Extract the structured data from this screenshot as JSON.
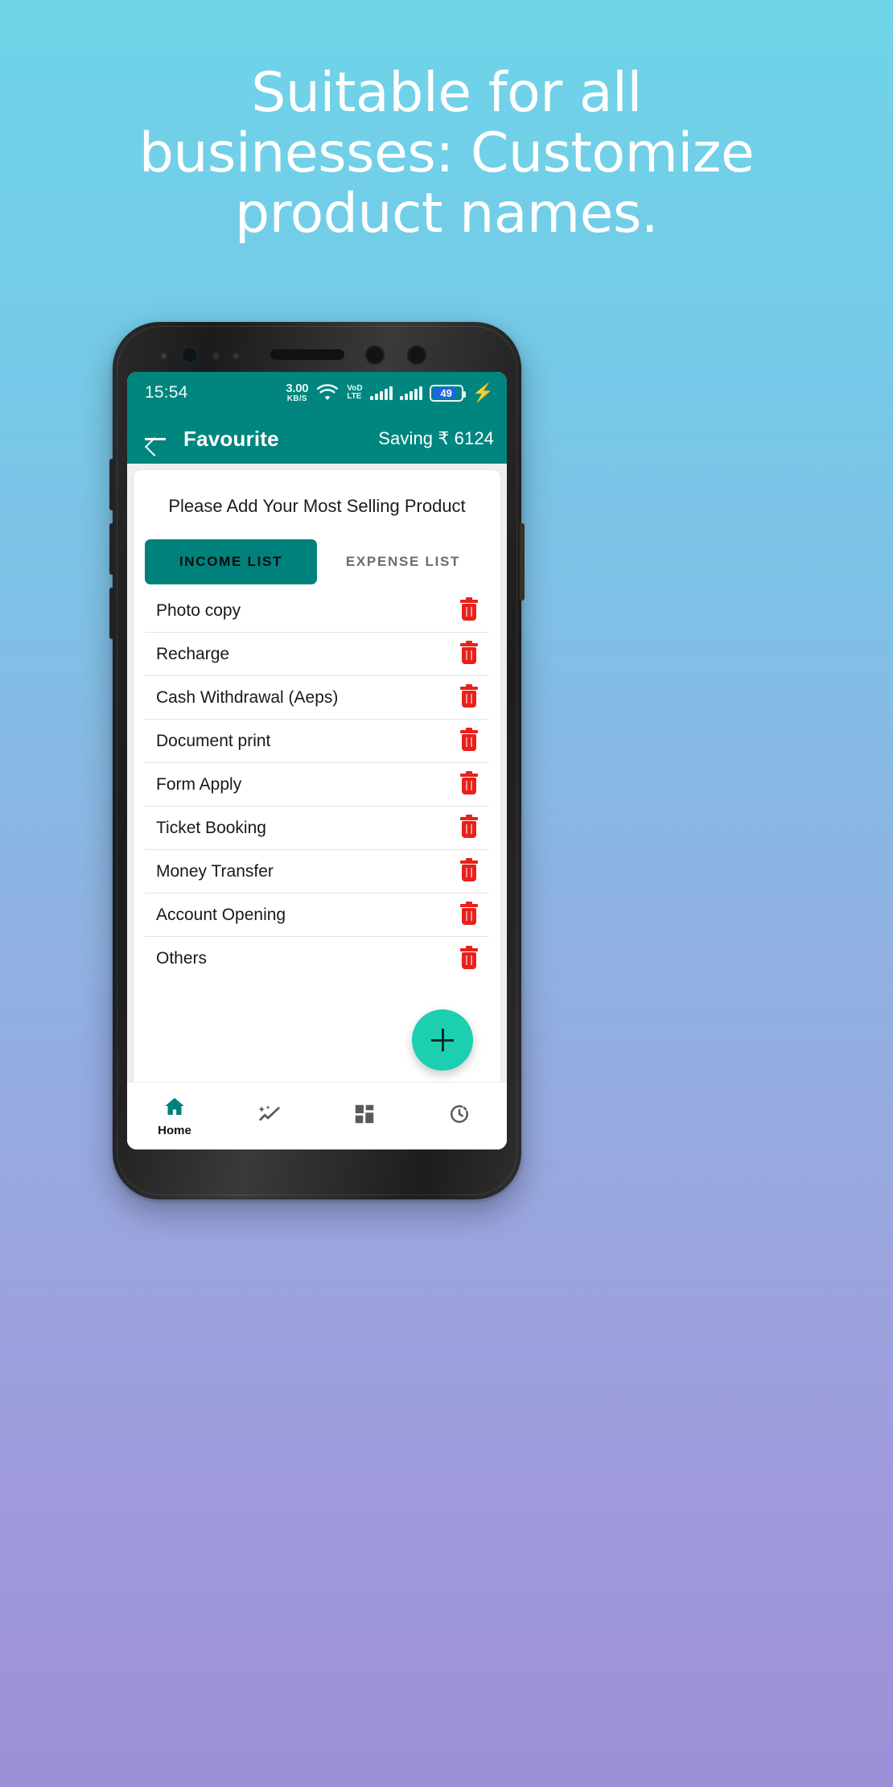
{
  "promo": {
    "headline_lines": [
      "Suitable for all",
      "businesses: Customize",
      "product names."
    ],
    "background_top_color": "#6fd4e8",
    "background_bottom_color": "#9d8fd8"
  },
  "phone": {
    "status_bar": {
      "time": "15:54",
      "data_speed_value": "3.00",
      "data_speed_unit": "KB/S",
      "network_line1": "VoD",
      "network_line2": "LTE",
      "battery_percent": "49",
      "charging_icon": "charging-bolt-icon",
      "wifi_icon": "wifi-icon",
      "signal_icon": "signal-bars-icon",
      "background_color": "#00857f"
    },
    "app_bar": {
      "back_icon": "back-arrow-icon",
      "title": "Favourite",
      "saving_label": "Saving ₹ 6124",
      "background_color": "#00857f"
    },
    "card": {
      "title": "Please Add Your Most Selling Product",
      "tabs": [
        {
          "label": "INCOME LIST",
          "active": true
        },
        {
          "label": "EXPENSE LIST",
          "active": false
        }
      ],
      "active_tab_color": "#00817c",
      "items": [
        {
          "label": "Photo copy",
          "delete_icon": "trash-icon"
        },
        {
          "label": "Recharge",
          "delete_icon": "trash-icon"
        },
        {
          "label": "Cash Withdrawal (Aeps)",
          "delete_icon": "trash-icon"
        },
        {
          "label": "Document print",
          "delete_icon": "trash-icon"
        },
        {
          "label": "Form Apply",
          "delete_icon": "trash-icon"
        },
        {
          "label": "Ticket Booking",
          "delete_icon": "trash-icon"
        },
        {
          "label": "Money Transfer",
          "delete_icon": "trash-icon"
        },
        {
          "label": "Account Opening",
          "delete_icon": "trash-icon"
        },
        {
          "label": "Others",
          "delete_icon": "trash-icon"
        }
      ],
      "delete_icon_color": "#e8211b",
      "fab": {
        "label": "+",
        "icon": "plus-icon",
        "color": "#1ccfb0"
      }
    },
    "bottom_nav": {
      "active_color": "#00817c",
      "inactive_color": "#5a5a5a",
      "items": [
        {
          "icon": "home-icon",
          "label": "Home",
          "active": true
        },
        {
          "icon": "magic-wand-sparkle-icon",
          "label": "",
          "active": false
        },
        {
          "icon": "dashboard-grid-icon",
          "label": "",
          "active": false
        },
        {
          "icon": "history-clock-icon",
          "label": "",
          "active": false
        }
      ]
    }
  }
}
